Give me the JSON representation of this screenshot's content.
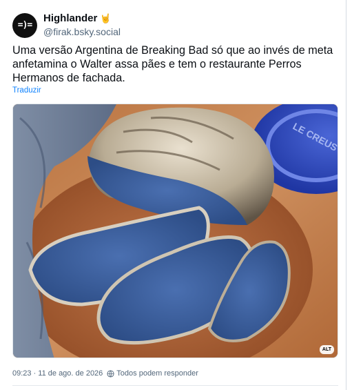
{
  "post": {
    "author_display_name": "Highlander",
    "author_emoji": "🤘",
    "author_handle": "@firak.bsky.social",
    "avatar_text": "=)=",
    "text": "Uma versão Argentina de Breaking Bad só que ao invés de meta anfetamina o Walter assa pães e tem o restaurante Perros Hermanos de fachada.",
    "translate_label": "Traduzir",
    "image": {
      "alt_badge": "ALT",
      "plate_text": "LE CREUS"
    },
    "timestamp": "09:23 · 11 de ago. de 2026",
    "reply_setting": "Todos podem responder"
  },
  "colors": {
    "link": "#1083fe",
    "muted": "#52667a",
    "bread_blue": "#3b5f9e"
  }
}
